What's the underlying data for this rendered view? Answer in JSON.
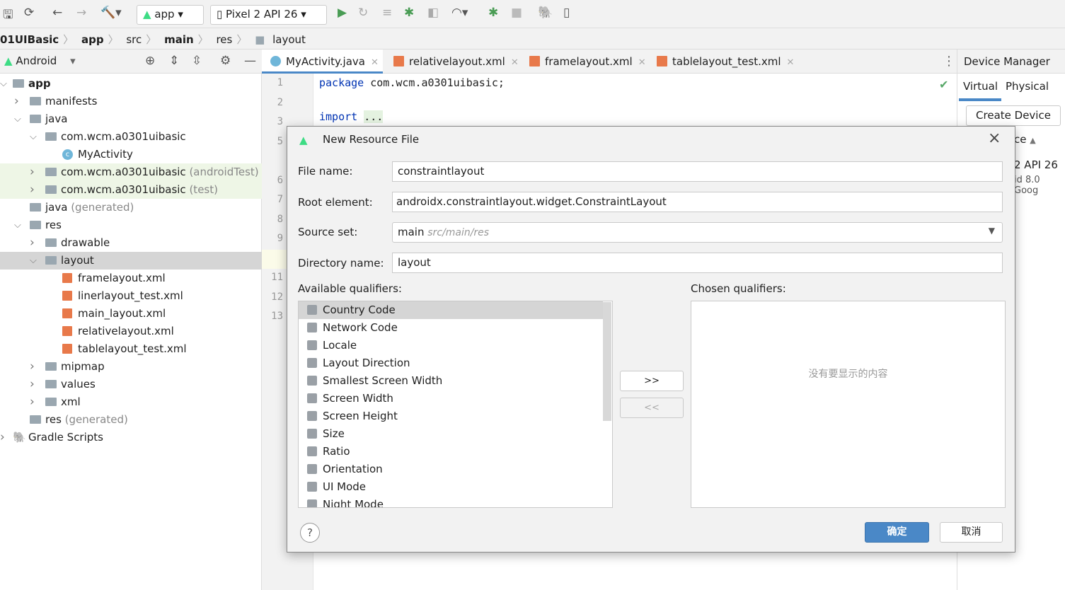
{
  "toolbar": {
    "run_config": "app",
    "device": "Pixel 2 API 26"
  },
  "breadcrumb": [
    "01UIBasic",
    "app",
    "src",
    "main",
    "res",
    "layout"
  ],
  "project": {
    "view": "Android",
    "tree": [
      {
        "label": "app",
        "suffix": "",
        "level": 0,
        "arrow": "v",
        "icon": "module",
        "bold": true
      },
      {
        "label": "manifests",
        "suffix": "",
        "level": 1,
        "arrow": ">",
        "icon": "folder"
      },
      {
        "label": "java",
        "suffix": "",
        "level": 1,
        "arrow": "v",
        "icon": "folder"
      },
      {
        "label": "com.wcm.a0301uibasic",
        "suffix": "",
        "level": 2,
        "arrow": "v",
        "icon": "package"
      },
      {
        "label": "MyActivity",
        "suffix": "",
        "level": 3,
        "arrow": "",
        "icon": "class"
      },
      {
        "label": "com.wcm.a0301uibasic",
        "suffix": " (androidTest)",
        "level": 2,
        "arrow": ">",
        "icon": "package",
        "hl": true
      },
      {
        "label": "com.wcm.a0301uibasic",
        "suffix": " (test)",
        "level": 2,
        "arrow": ">",
        "icon": "package",
        "hl": true
      },
      {
        "label": "java",
        "suffix": " (generated)",
        "level": 1,
        "arrow": "",
        "icon": "folder"
      },
      {
        "label": "res",
        "suffix": "",
        "level": 1,
        "arrow": "v",
        "icon": "folder"
      },
      {
        "label": "drawable",
        "suffix": "",
        "level": 2,
        "arrow": ">",
        "icon": "folder"
      },
      {
        "label": "layout",
        "suffix": "",
        "level": 2,
        "arrow": "v",
        "icon": "folder",
        "sel": true
      },
      {
        "label": "framelayout.xml",
        "suffix": "",
        "level": 3,
        "arrow": "",
        "icon": "xml"
      },
      {
        "label": "linerlayout_test.xml",
        "suffix": "",
        "level": 3,
        "arrow": "",
        "icon": "xml"
      },
      {
        "label": "main_layout.xml",
        "suffix": "",
        "level": 3,
        "arrow": "",
        "icon": "xml"
      },
      {
        "label": "relativelayout.xml",
        "suffix": "",
        "level": 3,
        "arrow": "",
        "icon": "xml"
      },
      {
        "label": "tablelayout_test.xml",
        "suffix": "",
        "level": 3,
        "arrow": "",
        "icon": "xml"
      },
      {
        "label": "mipmap",
        "suffix": "",
        "level": 2,
        "arrow": ">",
        "icon": "folder"
      },
      {
        "label": "values",
        "suffix": "",
        "level": 2,
        "arrow": ">",
        "icon": "folder"
      },
      {
        "label": "xml",
        "suffix": "",
        "level": 2,
        "arrow": ">",
        "icon": "folder"
      },
      {
        "label": "res",
        "suffix": " (generated)",
        "level": 1,
        "arrow": "",
        "icon": "folder"
      },
      {
        "label": "Gradle Scripts",
        "suffix": "",
        "level": 0,
        "arrow": ">",
        "icon": "gradle"
      }
    ]
  },
  "editor": {
    "tabs": [
      {
        "label": "MyActivity.java",
        "icon": "class",
        "active": true
      },
      {
        "label": "relativelayout.xml",
        "icon": "xml"
      },
      {
        "label": "framelayout.xml",
        "icon": "xml"
      },
      {
        "label": "tablelayout_test.xml",
        "icon": "xml"
      }
    ],
    "line_numbers": [
      "1",
      "2",
      "3",
      "5",
      "6",
      "7",
      "8",
      "9",
      "10",
      "11",
      "12",
      "13"
    ],
    "code": {
      "keyword": "package",
      "rest": " com.wcm.a0301uibasic;",
      "import": "import",
      "fold": "..."
    }
  },
  "device_manager": {
    "title": "Device Manager",
    "tabs": [
      "Virtual",
      "Physical"
    ],
    "create": "Create Device",
    "col_partial": "ce",
    "device_partial": "2 API 26",
    "device_sub_partial": "id 8.0 Goog"
  },
  "dialog": {
    "title": "New Resource File",
    "file_name_label": "File name:",
    "file_name": "constraintlayout",
    "root_label": "Root element:",
    "root": "androidx.constraintlayout.widget.ConstraintLayout",
    "source_label": "Source set:",
    "source": "main",
    "source_path": "src/main/res",
    "dir_label": "Directory name:",
    "dir": "layout",
    "available_label": "Available qualifiers:",
    "chosen_label": "Chosen qualifiers:",
    "qualifiers": [
      "Country Code",
      "Network Code",
      "Locale",
      "Layout Direction",
      "Smallest Screen Width",
      "Screen Width",
      "Screen Height",
      "Size",
      "Ratio",
      "Orientation",
      "UI Mode",
      "Night Mode"
    ],
    "add_btn": ">>",
    "remove_btn": "<<",
    "empty": "没有要显示的内容",
    "ok": "确定",
    "cancel": "取消",
    "help": "?"
  },
  "colors": {
    "accent": "#4a88c7",
    "selection": "#d5d5d5",
    "test_bg": "#eef6e6",
    "keyword": "#0033b3"
  }
}
